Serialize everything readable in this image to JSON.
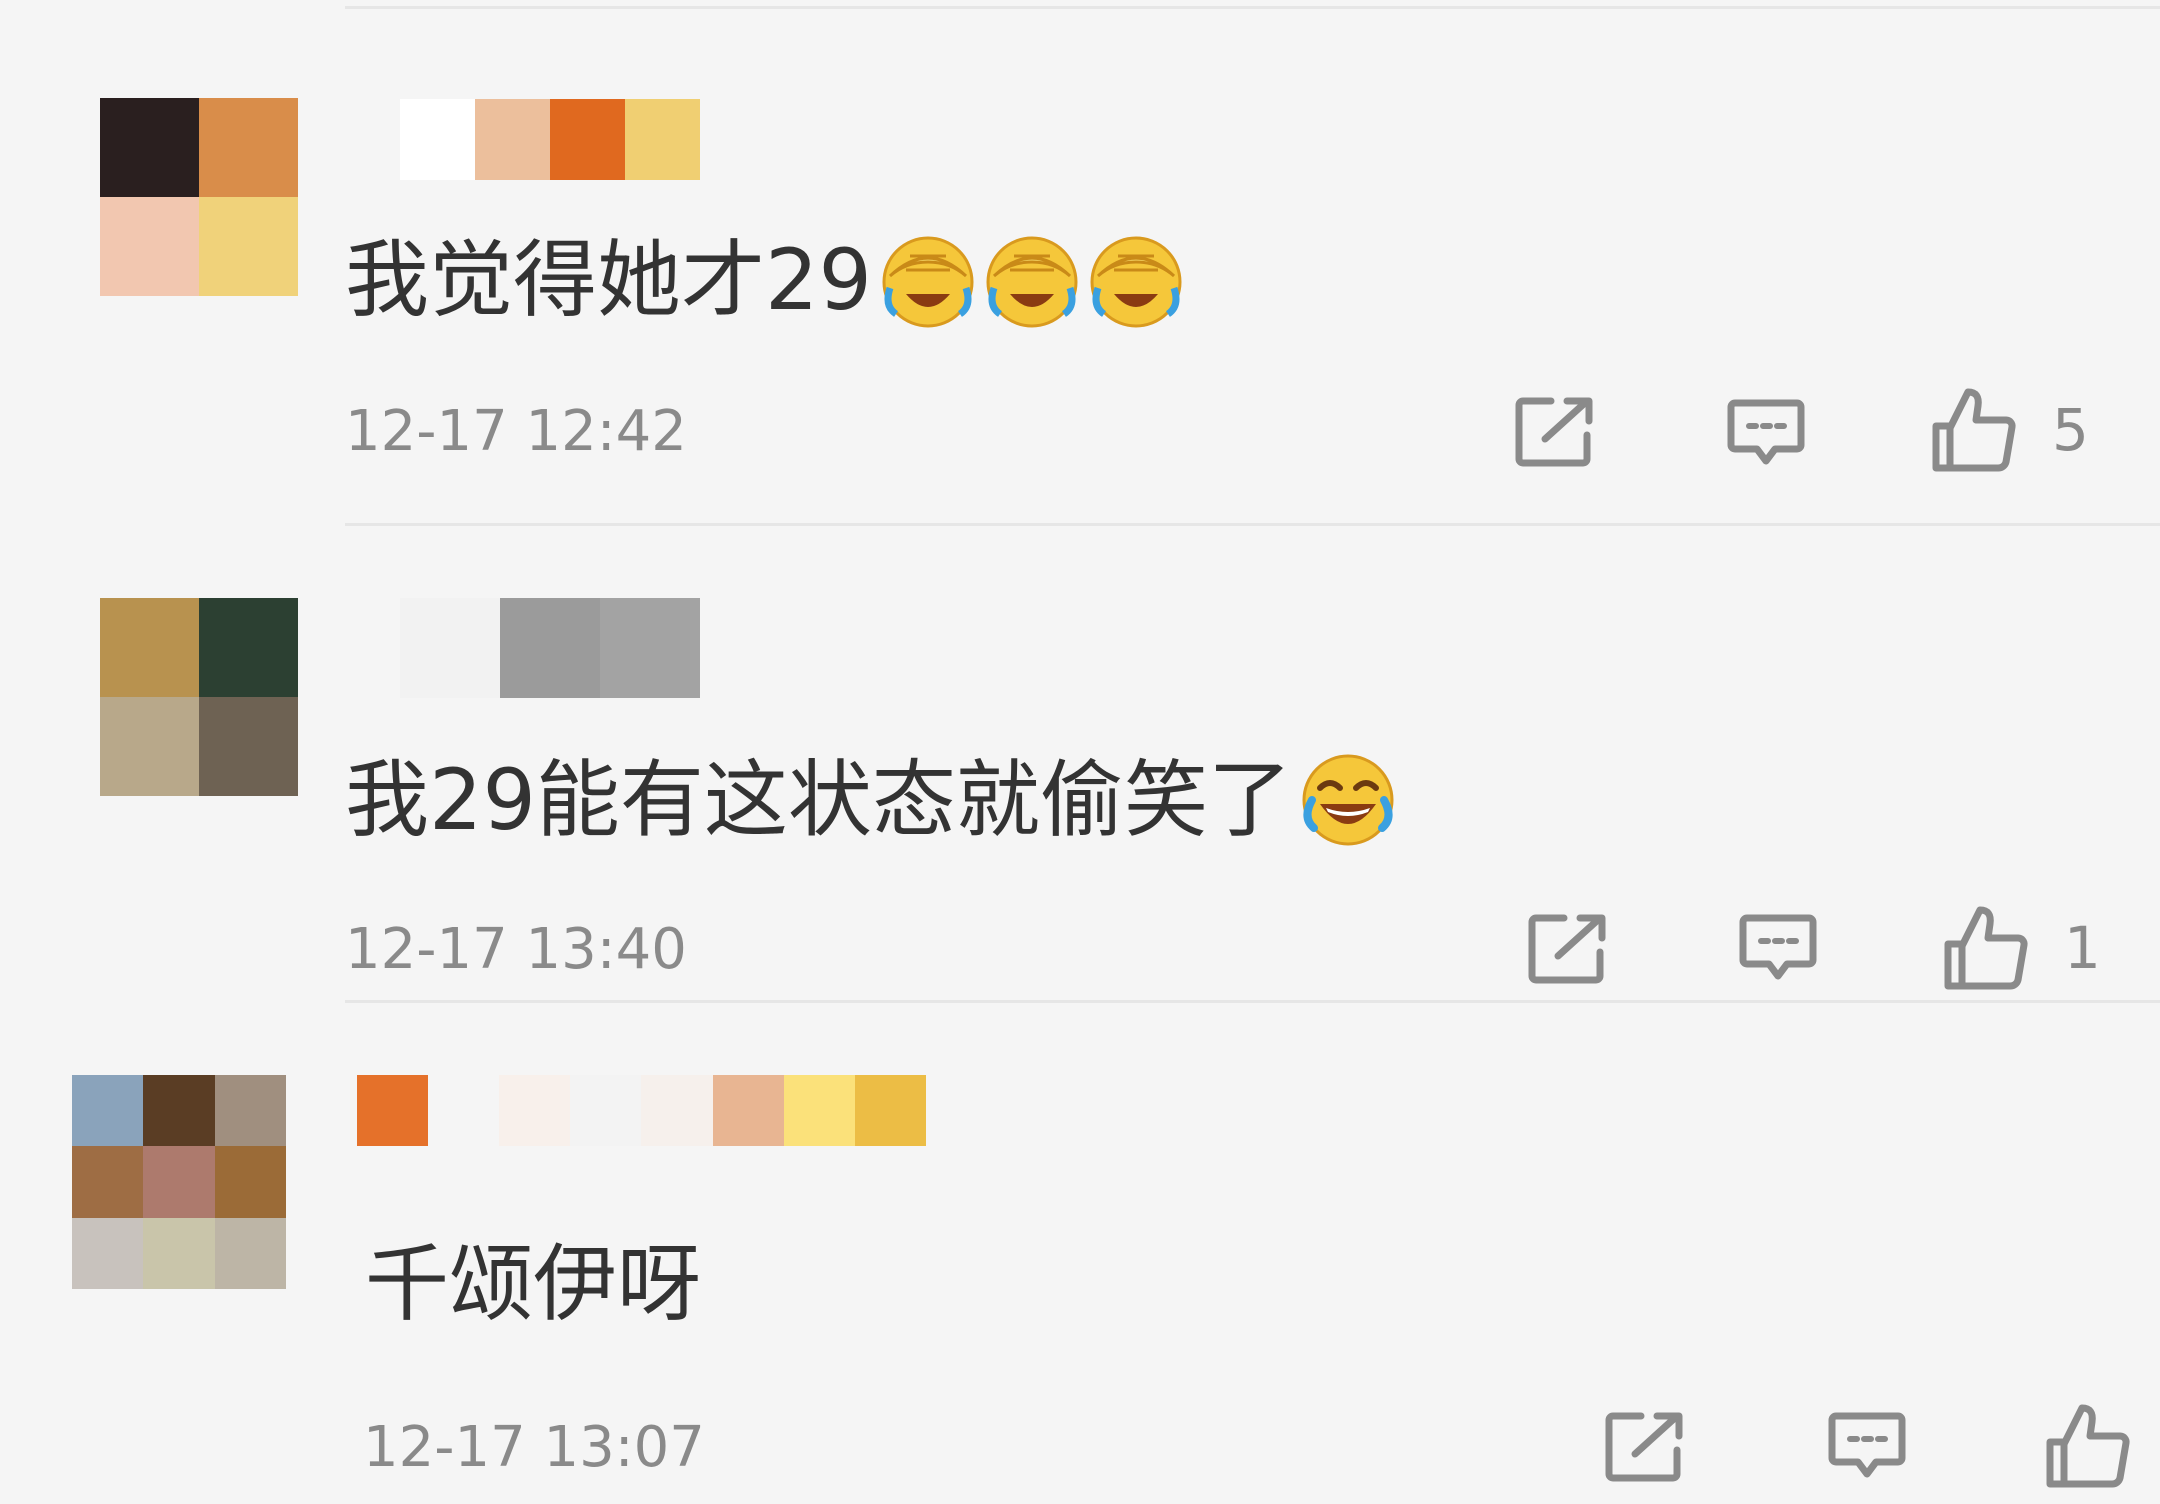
{
  "comments": [
    {
      "text": "我觉得她才29",
      "emojis": [
        "facepalm-laugh-emoji",
        "facepalm-laugh-emoji",
        "facepalm-laugh-emoji"
      ],
      "time": "12-17 12:42",
      "likes": "5",
      "avatar_colors": [
        "#2a1f1f",
        "#d98d4a",
        "#f2c7b0",
        "#f0d27a"
      ],
      "name_colors": [
        "#ffffff",
        "#ecbf9c",
        "#e0691f",
        "#f0cf72"
      ]
    },
    {
      "text": "我29能有这状态就偷笑了",
      "emojis": [
        "tears-of-joy-emoji"
      ],
      "time": "12-17 13:40",
      "likes": "1",
      "avatar_colors": [
        "#b8924f",
        "#2c4032",
        "#b8a88a",
        "#6e6253"
      ],
      "name_colors": [
        "#f2f2f2",
        "#9b9b9b",
        "#a3a3a3"
      ]
    },
    {
      "text": "千颂伊呀",
      "emojis": [],
      "time": "12-17 13:07",
      "likes": "",
      "avatar_colors": [
        "#8aa3bb",
        "#5a3d24",
        "#a08f7f",
        "#9e6d44",
        "#ad7a6d",
        "#9b6b37",
        "#c8c2bd",
        "#c9c5aa",
        "#bdb5a6"
      ],
      "name_colors": [
        "#e5712a",
        "#f5f5f5",
        "#f8f0eb",
        "#f3f3f3",
        "#f6f0ec",
        "#e8b592",
        "#fbe17a",
        "#ecbd45"
      ]
    }
  ],
  "icons": {
    "repost": "share-box-icon",
    "reply": "comment-bubble-icon",
    "like": "thumbs-up-icon"
  },
  "colors": {
    "text": "#333333",
    "meta": "#8a8a8a",
    "divider": "#e6e6e6",
    "background": "#f5f5f5"
  }
}
